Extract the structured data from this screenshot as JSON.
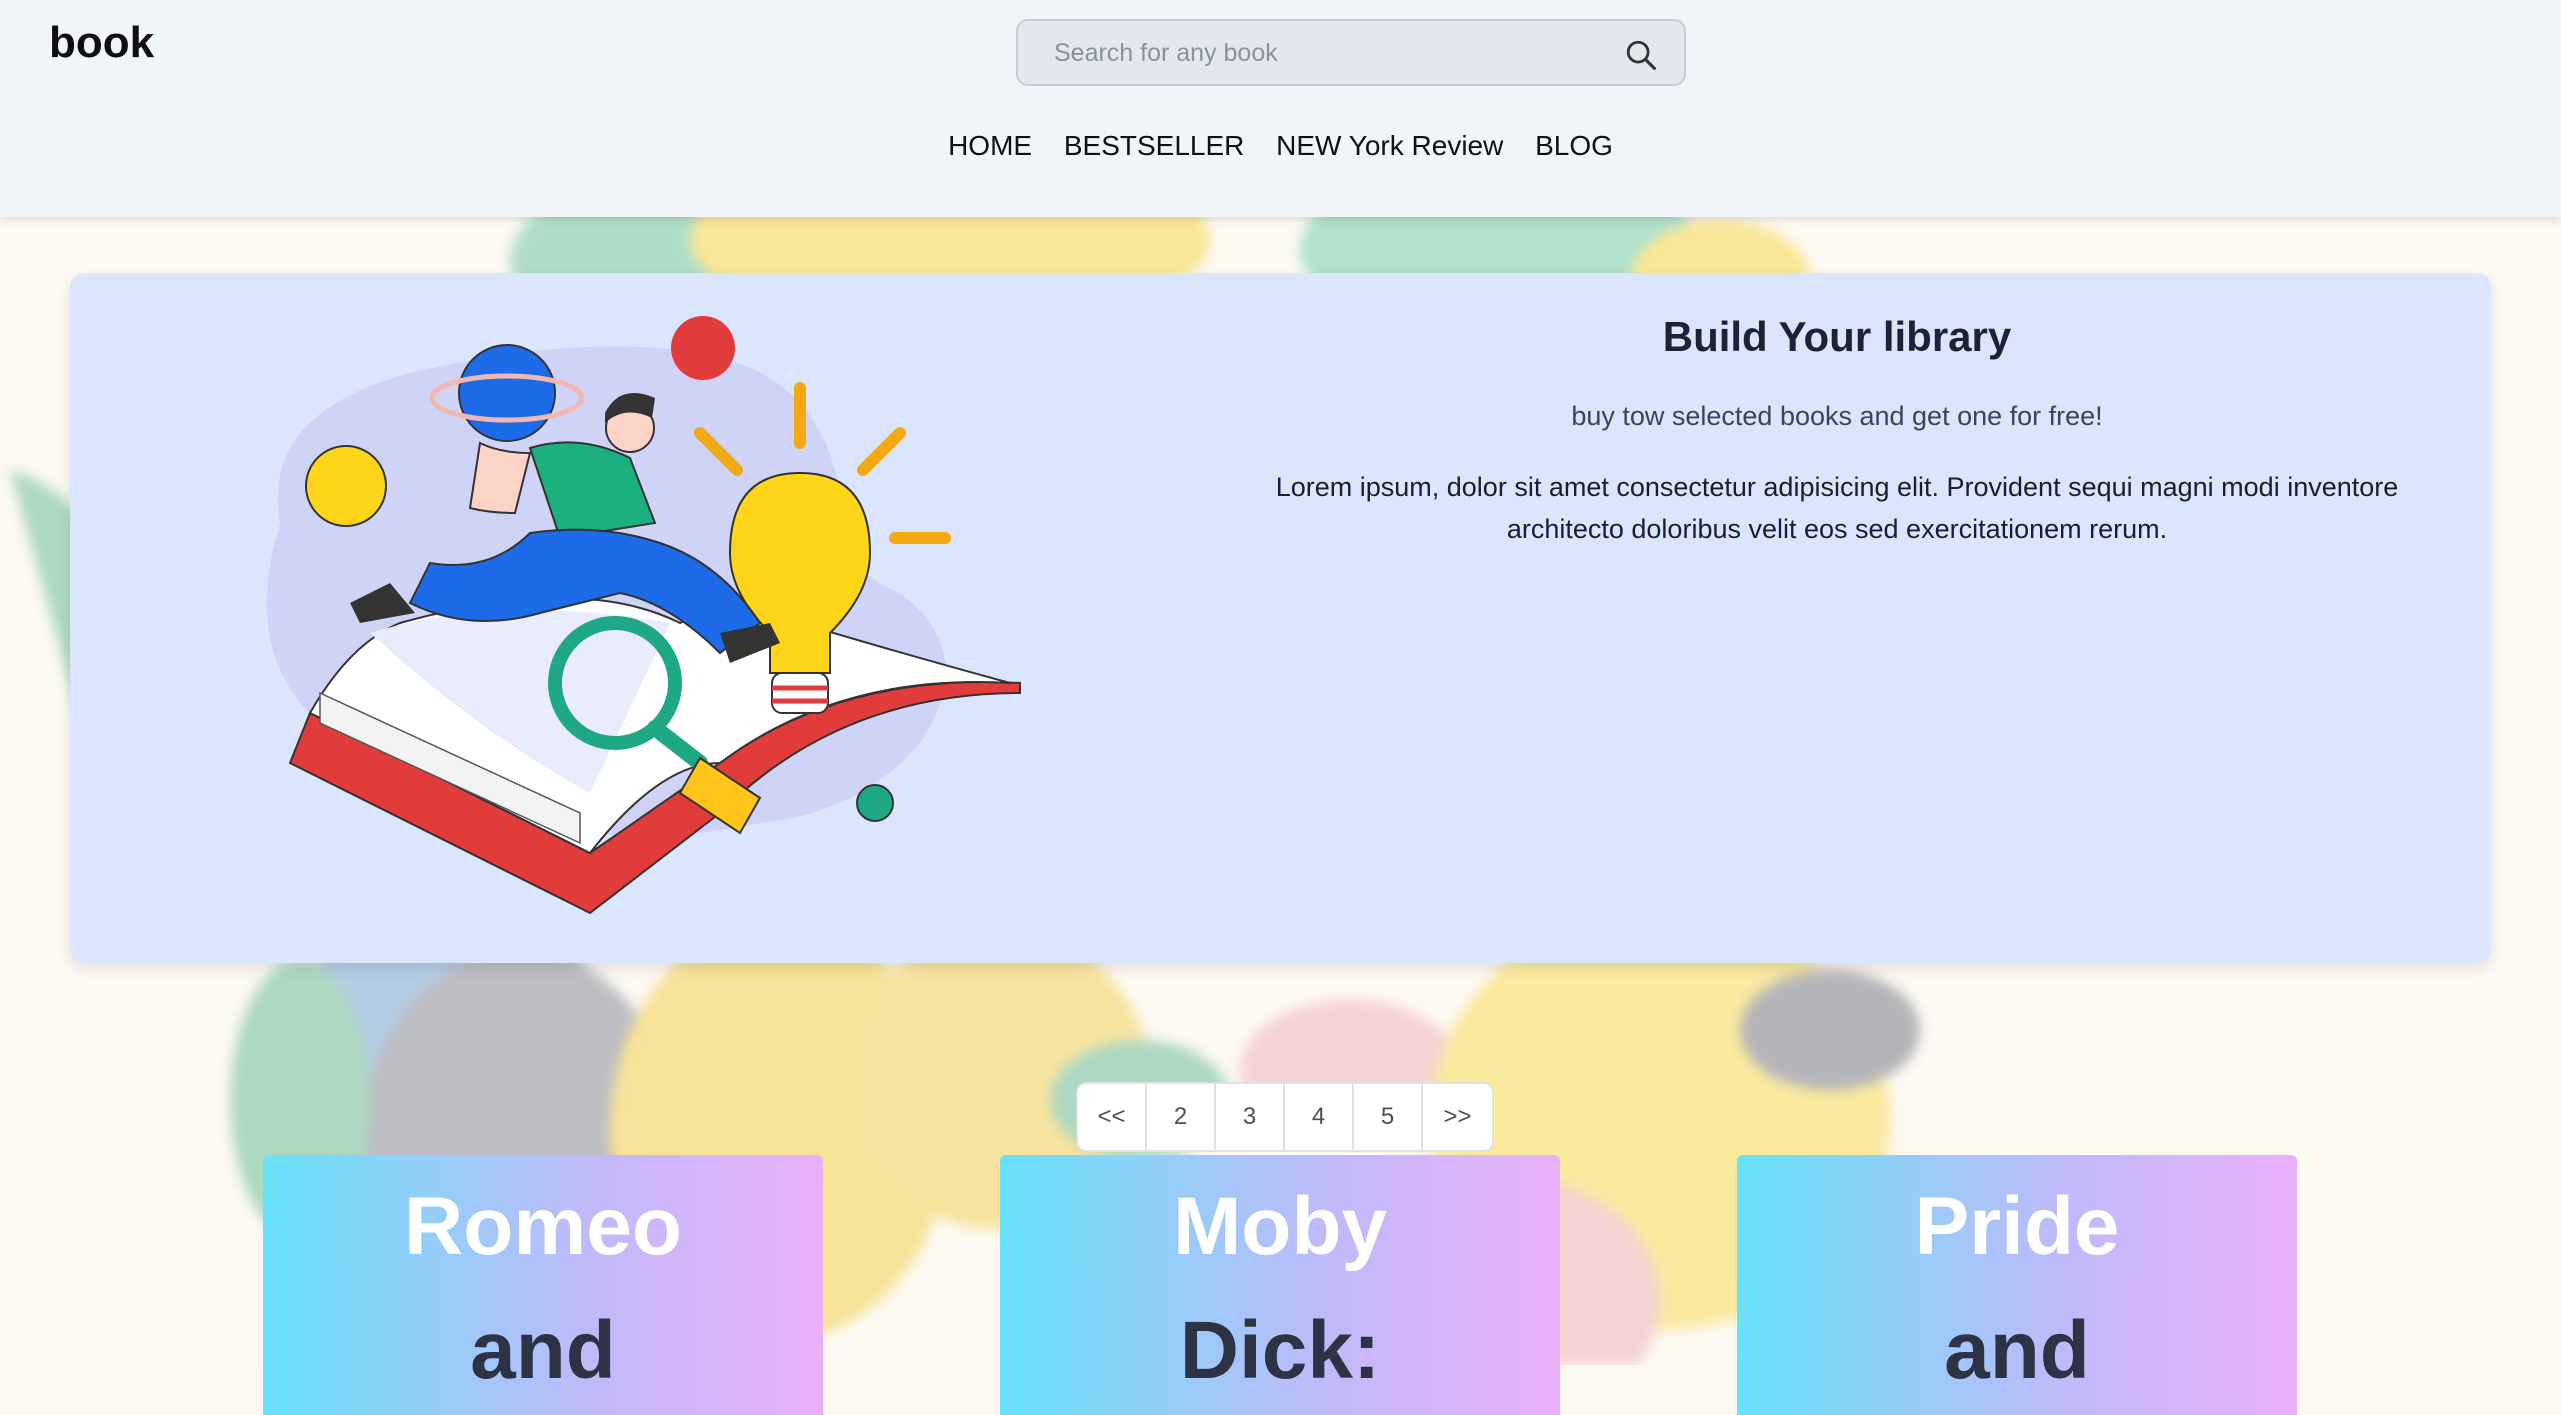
{
  "header": {
    "logo": "book",
    "search": {
      "placeholder": "Search for any book",
      "icon": "search-icon"
    },
    "nav": [
      "HOME",
      "BESTSELLER",
      "NEW York Review",
      "BLOG"
    ]
  },
  "hero": {
    "title": "Build Your library",
    "subtitle": "buy tow selected books and get one for free!",
    "body": "Lorem ipsum, dolor sit amet consectetur adipisicing elit. Provident sequi magni modi inventore architecto doloribus velit eos sed exercitationem rerum."
  },
  "pagination": [
    "<<",
    "2",
    "3",
    "4",
    "5",
    ">>"
  ],
  "books": [
    {
      "line1": "Romeo",
      "line2": "and"
    },
    {
      "line1": "Moby",
      "line2": "Dick:"
    },
    {
      "line1": "Pride",
      "line2": "and"
    }
  ],
  "colors": {
    "header_bg": "#f1f4f9",
    "hero_bg": "#dbe6fd",
    "card_gradient_start": "#67e2f8",
    "card_gradient_end": "#eab0f9"
  }
}
